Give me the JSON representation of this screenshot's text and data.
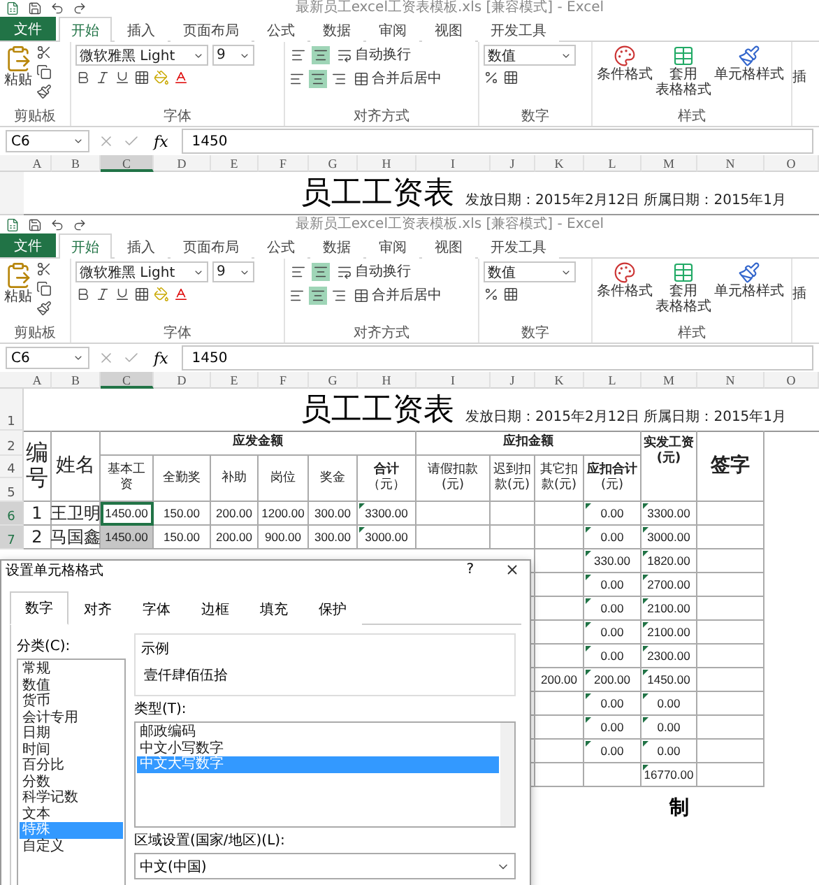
{
  "windows": [
    {
      "title": "最新员工excel工资表模板.xls  [兼容模式] - Excel",
      "file_tab": "文件",
      "tabs": [
        {
          "label": "开始",
          "selected": true
        },
        {
          "label": "插入",
          "selected": false
        },
        {
          "label": "页面布局",
          "selected": false
        },
        {
          "label": "公式",
          "selected": false
        },
        {
          "label": "数据",
          "selected": false
        },
        {
          "label": "审阅",
          "selected": false
        },
        {
          "label": "视图",
          "selected": false
        },
        {
          "label": "开发工具",
          "selected": false
        }
      ],
      "ribbon": {
        "paste": "粘贴",
        "clipboard_label": "剪贴板",
        "font_name": "微软雅黑 Light",
        "font_size": "9",
        "font_label": "字体",
        "wrap": "自动换行",
        "merge": "合并后居中",
        "align_label": "对齐方式",
        "align_middle": true,
        "align_center": true,
        "number_format": "数值",
        "number_label": "数字",
        "conditional": "条件格式",
        "table_format": [
          "套用",
          "表格格式"
        ],
        "cell_style": "单元格样式",
        "styles_label": "样式",
        "cut_button": "插"
      },
      "name_box": "C6",
      "fx": "fx",
      "formula": "1450",
      "columns": [
        {
          "label": "A",
          "selected": false
        },
        {
          "label": "B",
          "selected": false
        },
        {
          "label": "C",
          "selected": true
        },
        {
          "label": "D",
          "selected": false
        },
        {
          "label": "E",
          "selected": false
        },
        {
          "label": "F",
          "selected": false
        },
        {
          "label": "G",
          "selected": false
        },
        {
          "label": "H",
          "selected": false
        },
        {
          "label": "I",
          "selected": false
        },
        {
          "label": "J",
          "selected": false
        },
        {
          "label": "K",
          "selected": false
        },
        {
          "label": "L",
          "selected": false
        },
        {
          "label": "M",
          "selected": false
        },
        {
          "label": "N",
          "selected": false
        },
        {
          "label": "O",
          "selected": false
        }
      ],
      "sheet_title": "员工工资表",
      "sheet_date": "发放日期：2015年2月12日 所属日期：2015年1月"
    },
    {
      "title": "最新员工excel工资表模板.xls  [兼容模式] - Excel",
      "file_tab": "文件",
      "tabs": [
        {
          "label": "开始",
          "selected": true
        },
        {
          "label": "插入",
          "selected": false
        },
        {
          "label": "页面布局",
          "selected": false
        },
        {
          "label": "公式",
          "selected": false
        },
        {
          "label": "数据",
          "selected": false
        },
        {
          "label": "审阅",
          "selected": false
        },
        {
          "label": "视图",
          "selected": false
        },
        {
          "label": "开发工具",
          "selected": false
        }
      ],
      "ribbon": {
        "paste": "粘贴",
        "clipboard_label": "剪贴板",
        "font_name": "微软雅黑 Light",
        "font_size": "9",
        "font_label": "字体",
        "wrap": "自动换行",
        "merge": "合并后居中",
        "align_label": "对齐方式",
        "align_middle": true,
        "align_center": true,
        "number_format": "数值",
        "number_label": "数字",
        "conditional": "条件格式",
        "table_format": [
          "套用",
          "表格格式"
        ],
        "cell_style": "单元格样式",
        "styles_label": "样式",
        "cut_button": "插"
      },
      "name_box": "C6",
      "fx": "fx",
      "formula": "1450",
      "columns": [
        {
          "label": "A",
          "selected": false
        },
        {
          "label": "B",
          "selected": false
        },
        {
          "label": "C",
          "selected": true
        },
        {
          "label": "D",
          "selected": false
        },
        {
          "label": "E",
          "selected": false
        },
        {
          "label": "F",
          "selected": false
        },
        {
          "label": "G",
          "selected": false
        },
        {
          "label": "H",
          "selected": false
        },
        {
          "label": "I",
          "selected": false
        },
        {
          "label": "J",
          "selected": false
        },
        {
          "label": "K",
          "selected": false
        },
        {
          "label": "L",
          "selected": false
        },
        {
          "label": "M",
          "selected": false
        },
        {
          "label": "N",
          "selected": false
        },
        {
          "label": "O",
          "selected": false
        }
      ],
      "title_row": "1",
      "sheet_title": "员工工资表",
      "sheet_date": "发放日期：2015年2月12日 所属日期：2015年1月",
      "table": {
        "header_rows": [
          "2",
          "4",
          "5"
        ],
        "no": "编号",
        "name": "姓名",
        "pay_group": "应发金额",
        "pay_cols": [
          "基本工资",
          "全勤奖",
          "补助",
          "岗位",
          "奖金",
          "**合计**（元）"
        ],
        "deduct_group": "应扣金额",
        "deduct_cols": [
          "请假扣款(元)",
          "迟到扣款(元)",
          "其它扣款(元)",
          "**应扣合计**(元)"
        ],
        "net": "实发工资(元)",
        "sign": "签字",
        "rows": [
          {
            "row": "6",
            "selected": true,
            "cells": {
              "A": {
                "text": "1"
              },
              "B": {
                "text": "王卫明"
              },
              "C": {
                "text": "1450.00",
                "active": true
              },
              "D": {
                "text": "150.00"
              },
              "E": {
                "text": "200.00"
              },
              "F": {
                "text": "1200.00"
              },
              "G": {
                "text": "300.00"
              },
              "H": {
                "text": "3300.00",
                "flagged": true
              },
              "L": {
                "text": "0.00",
                "flagged": true
              },
              "M": {
                "text": "3300.00",
                "flagged": true
              }
            }
          },
          {
            "row": "7",
            "selected": true,
            "cells": {
              "A": {
                "text": "2"
              },
              "B": {
                "text": "马国鑫"
              },
              "C": {
                "text": "1450.00",
                "selected": true,
                "active": false
              },
              "D": {
                "text": "150.00"
              },
              "E": {
                "text": "200.00"
              },
              "F": {
                "text": "900.00"
              },
              "G": {
                "text": "300.00"
              },
              "H": {
                "text": "3000.00",
                "flagged": true
              },
              "L": {
                "text": "0.00",
                "flagged": true
              },
              "M": {
                "text": "3000.00",
                "flagged": true
              }
            }
          },
          {
            "cells": {
              "L": {
                "text": "330.00",
                "flagged": true
              },
              "M": {
                "text": "1820.00",
                "flagged": true
              }
            }
          },
          {
            "cells": {
              "L": {
                "text": "0.00",
                "flagged": true
              },
              "M": {
                "text": "2700.00",
                "flagged": true
              }
            }
          },
          {
            "cells": {
              "L": {
                "text": "0.00",
                "flagged": true
              },
              "M": {
                "text": "2100.00",
                "flagged": true
              }
            }
          },
          {
            "cells": {
              "L": {
                "text": "0.00",
                "flagged": true
              },
              "M": {
                "text": "2100.00",
                "flagged": true
              }
            }
          },
          {
            "cells": {
              "L": {
                "text": "0.00",
                "flagged": true
              },
              "M": {
                "text": "2300.00",
                "flagged": true
              }
            }
          },
          {
            "cells": {
              "K": {
                "text": "200.00"
              },
              "L": {
                "text": "200.00",
                "flagged": true
              },
              "M": {
                "text": "1450.00",
                "flagged": true
              }
            }
          },
          {
            "cells": {
              "L": {
                "text": "0.00",
                "flagged": true
              },
              "M": {
                "text": "0.00",
                "flagged": true
              }
            }
          },
          {
            "cells": {
              "L": {
                "text": "0.00",
                "flagged": true
              },
              "M": {
                "text": "0.00",
                "flagged": true
              }
            }
          },
          {
            "cells": {
              "L": {
                "text": "0.00",
                "flagged": true
              },
              "M": {
                "text": "0.00",
                "flagged": true
              }
            }
          },
          {
            "cells": {
              "M": {
                "text": "16770.00",
                "flagged": true
              }
            }
          }
        ],
        "footer": "制"
      }
    }
  ],
  "dialog": {
    "title": "设置单元格格式",
    "help": "?",
    "tabs": [
      {
        "label": "数字",
        "selected": true
      },
      {
        "label": "对齐",
        "selected": false
      },
      {
        "label": "字体",
        "selected": false
      },
      {
        "label": "边框",
        "selected": false
      },
      {
        "label": "填充",
        "selected": false
      },
      {
        "label": "保护",
        "selected": false
      }
    ],
    "category_label": "分类(C):",
    "categories": [
      {
        "label": "常规",
        "selected": false
      },
      {
        "label": "数值",
        "selected": false
      },
      {
        "label": "货币",
        "selected": false
      },
      {
        "label": "会计专用",
        "selected": false
      },
      {
        "label": "日期",
        "selected": false
      },
      {
        "label": "时间",
        "selected": false
      },
      {
        "label": "百分比",
        "selected": false
      },
      {
        "label": "分数",
        "selected": false
      },
      {
        "label": "科学记数",
        "selected": false
      },
      {
        "label": "文本",
        "selected": false
      },
      {
        "label": "特殊",
        "selected": true
      },
      {
        "label": "自定义",
        "selected": false
      }
    ],
    "sample_label": "示例",
    "sample": "壹仟肆佰伍拾",
    "type_label": "类型(T):",
    "types": [
      {
        "label": "邮政编码",
        "selected": false
      },
      {
        "label": "中文小写数字",
        "selected": false
      },
      {
        "label": "中文大写数字",
        "selected": true
      }
    ],
    "locale_label": "区域设置(国家/地区)(L):",
    "locale": "中文(中国)"
  }
}
